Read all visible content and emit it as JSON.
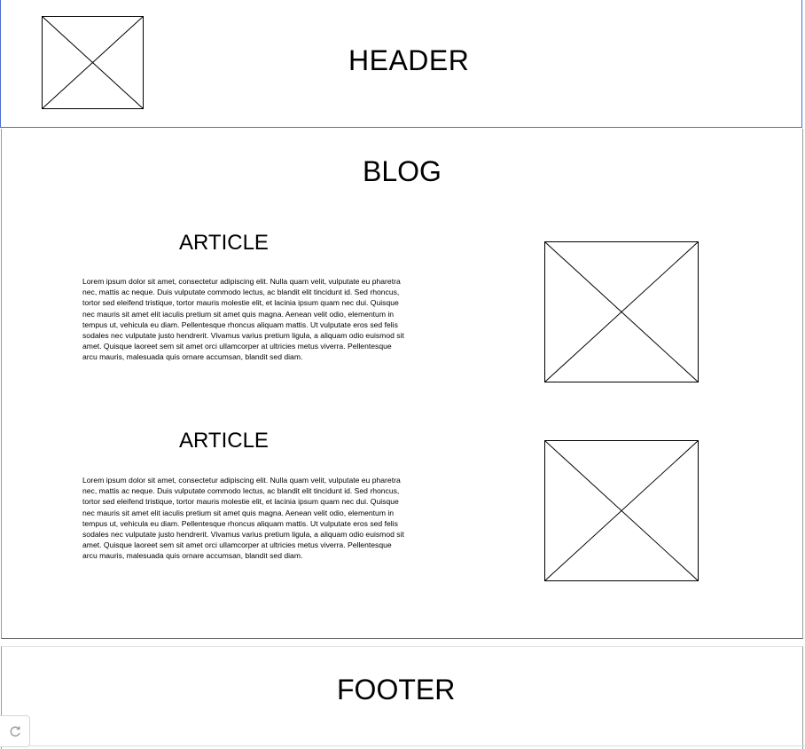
{
  "header": {
    "title": "HEADER",
    "logo_icon": "image-placeholder-icon"
  },
  "blog": {
    "title": "BLOG",
    "articles": [
      {
        "title": "ARTICLE",
        "text": "Lorem ipsum dolor sit amet, consectetur adipiscing elit. Nulla quam velit, vulputate eu pharetra nec, mattis ac neque. Duis vulputate commodo lectus, ac blandit elit tincidunt id. Sed rhoncus, tortor sed eleifend tristique, tortor mauris molestie elit, et lacinia ipsum quam nec dui. Quisque nec mauris sit amet elit iaculis pretium sit amet quis magna. Aenean velit odio, elementum in tempus ut, vehicula eu diam. Pellentesque rhoncus aliquam mattis. Ut vulputate eros sed felis sodales nec vulputate justo hendrerit. Vivamus varius pretium ligula, a aliquam odio euismod sit amet. Quisque laoreet sem sit amet orci ullamcorper at ultricies metus viverra. Pellentesque arcu mauris, malesuada quis ornare accumsan, blandit sed diam.",
        "image_icon": "image-placeholder-icon"
      },
      {
        "title": "ARTICLE",
        "text": "Lorem ipsum dolor sit amet, consectetur adipiscing elit. Nulla quam velit, vulputate eu pharetra nec, mattis ac neque. Duis vulputate commodo lectus, ac blandit elit tincidunt id. Sed rhoncus, tortor sed eleifend tristique, tortor mauris molestie elit, et lacinia ipsum quam nec dui. Quisque nec mauris sit amet elit iaculis pretium sit amet quis magna. Aenean velit odio, elementum in tempus ut, vehicula eu diam. Pellentesque rhoncus aliquam mattis. Ut vulputate eros sed felis sodales nec vulputate justo hendrerit. Vivamus varius pretium ligula, a aliquam odio euismod sit amet. Quisque laoreet sem sit amet orci ullamcorper at ultricies metus viverra. Pellentesque arcu mauris, malesuada quis ornare accumsan, blandit sed diam.",
        "image_icon": "image-placeholder-icon"
      }
    ]
  },
  "footer": {
    "title": "FOOTER"
  },
  "toolbar": {
    "redo_icon": "redo-icon"
  },
  "colors": {
    "header_border": "#4a6fd1",
    "section_border": "#9a9a9a"
  }
}
